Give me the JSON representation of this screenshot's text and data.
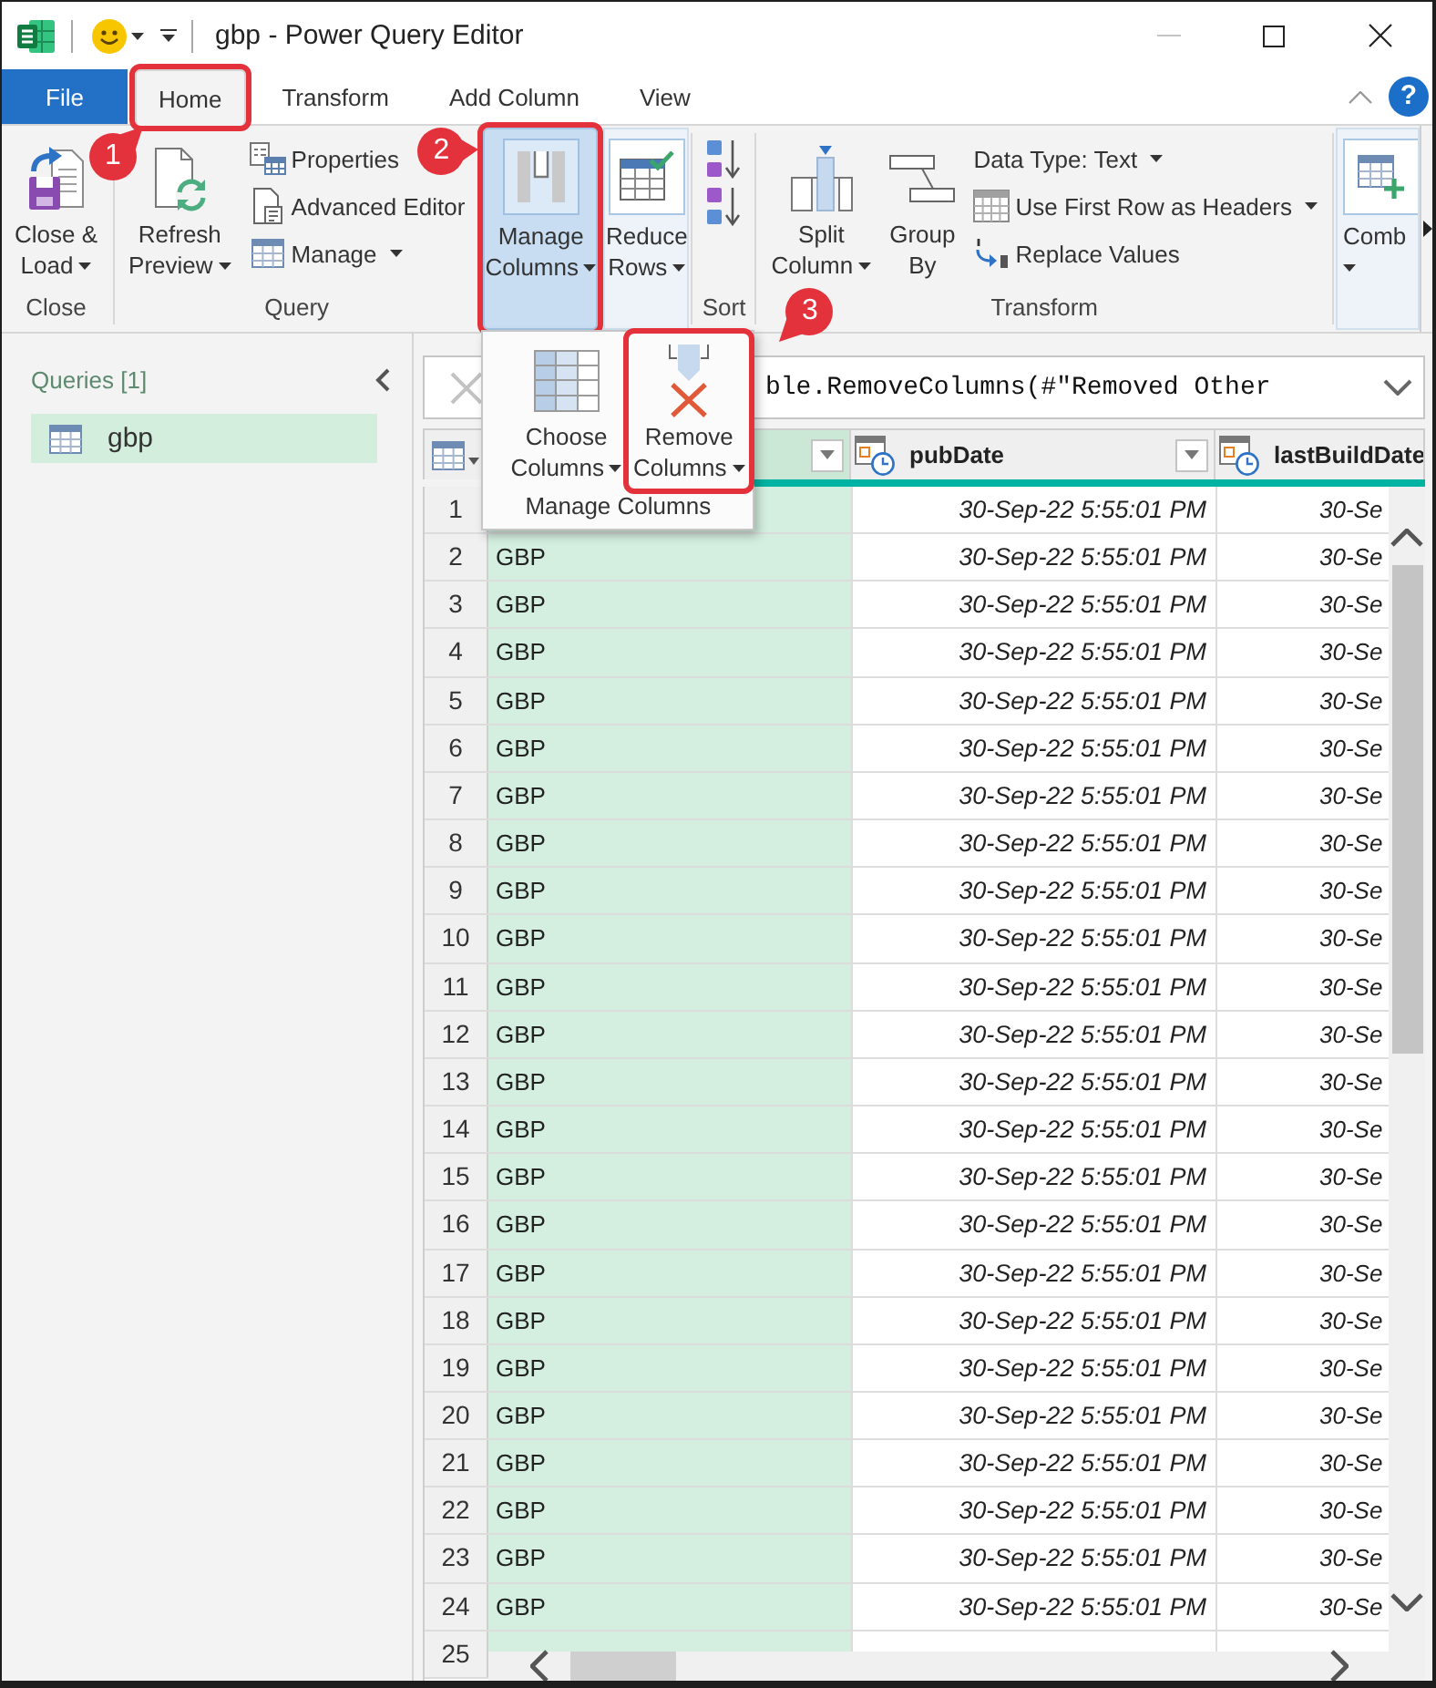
{
  "window": {
    "title": "gbp - Power Query Editor"
  },
  "tabs": [
    {
      "label": "File",
      "kind": "file",
      "selected": false
    },
    {
      "label": "Home",
      "kind": "tab",
      "selected": true,
      "step": "1"
    },
    {
      "label": "Transform",
      "kind": "tab",
      "selected": false
    },
    {
      "label": "Add Column",
      "kind": "tab",
      "selected": false
    },
    {
      "label": "View",
      "kind": "tab",
      "selected": false
    }
  ],
  "help_button": "?",
  "ribbon": {
    "groups": [
      {
        "kind": "group",
        "label": "Close",
        "items": [
          {
            "kind": "large",
            "lines": [
              "Close &",
              "Load"
            ],
            "dropdown": true
          }
        ]
      },
      {
        "kind": "group",
        "label": "Query",
        "items": [
          {
            "kind": "large",
            "lines": [
              "Refresh",
              "Preview"
            ],
            "dropdown": true
          },
          {
            "kind": "small",
            "label": "Properties",
            "dropdown": false
          },
          {
            "kind": "small",
            "label": "Advanced Editor",
            "dropdown": false
          },
          {
            "kind": "small",
            "label": "Manage",
            "dropdown": true
          }
        ]
      },
      {
        "kind": "collapsed",
        "lines": [
          "Manage",
          "Columns"
        ],
        "dropdown": true,
        "expanded": true,
        "step": "2",
        "menu": {
          "label": "Manage Columns",
          "items": [
            {
              "lines": [
                "Choose",
                "Columns"
              ],
              "dropdown": true
            },
            {
              "lines": [
                "Remove",
                "Columns"
              ],
              "dropdown": true,
              "step": "3"
            }
          ]
        }
      },
      {
        "kind": "collapsed",
        "lines": [
          "Reduce",
          "Rows"
        ],
        "dropdown": true,
        "expanded": false
      },
      {
        "kind": "group",
        "label": "Sort",
        "items": [
          {
            "kind": "icon"
          },
          {
            "kind": "icon"
          }
        ]
      },
      {
        "kind": "group",
        "label": "Transform",
        "items": [
          {
            "kind": "large",
            "lines": [
              "Split",
              "Column"
            ],
            "dropdown": true
          },
          {
            "kind": "large",
            "lines": [
              "Group",
              "By"
            ],
            "dropdown": false
          },
          {
            "kind": "small",
            "label": "Data Type: Text",
            "dropdown": true
          },
          {
            "kind": "small",
            "label": "Use First Row as Headers",
            "dropdown": true
          },
          {
            "kind": "small",
            "label": "Replace Values",
            "dropdown": false
          }
        ]
      },
      {
        "kind": "collapsed",
        "lines": [
          "Comb"
        ],
        "dropdown": true,
        "expanded": false
      }
    ]
  },
  "queries": {
    "title": "Queries [1]",
    "items": [
      {
        "label": "gbp",
        "selected": true
      }
    ]
  },
  "formula_bar": {
    "formula": "ble.RemoveColumns(#\"Removed Other"
  },
  "table": {
    "columns": [
      {
        "selected": true,
        "filter": true
      },
      {
        "name": "pubDate",
        "kind": "datetime",
        "selected": false,
        "filter": true
      },
      {
        "name": "lastBuildDate",
        "kind": "datetime",
        "selected": false
      }
    ],
    "rows": [
      {
        "number": "1",
        "cells": [
          null,
          "30-Sep-22 5:55:01 PM",
          "30-Se"
        ]
      },
      {
        "number": "2",
        "cells": [
          "GBP",
          "30-Sep-22 5:55:01 PM",
          "30-Se"
        ]
      },
      {
        "number": "3",
        "cells": [
          "GBP",
          "30-Sep-22 5:55:01 PM",
          "30-Se"
        ]
      },
      {
        "number": "4",
        "cells": [
          "GBP",
          "30-Sep-22 5:55:01 PM",
          "30-Se"
        ]
      },
      {
        "number": "5",
        "cells": [
          "GBP",
          "30-Sep-22 5:55:01 PM",
          "30-Se"
        ]
      },
      {
        "number": "6",
        "cells": [
          "GBP",
          "30-Sep-22 5:55:01 PM",
          "30-Se"
        ]
      },
      {
        "number": "7",
        "cells": [
          "GBP",
          "30-Sep-22 5:55:01 PM",
          "30-Se"
        ]
      },
      {
        "number": "8",
        "cells": [
          "GBP",
          "30-Sep-22 5:55:01 PM",
          "30-Se"
        ]
      },
      {
        "number": "9",
        "cells": [
          "GBP",
          "30-Sep-22 5:55:01 PM",
          "30-Se"
        ]
      },
      {
        "number": "10",
        "cells": [
          "GBP",
          "30-Sep-22 5:55:01 PM",
          "30-Se"
        ]
      },
      {
        "number": "11",
        "cells": [
          "GBP",
          "30-Sep-22 5:55:01 PM",
          "30-Se"
        ]
      },
      {
        "number": "12",
        "cells": [
          "GBP",
          "30-Sep-22 5:55:01 PM",
          "30-Se"
        ]
      },
      {
        "number": "13",
        "cells": [
          "GBP",
          "30-Sep-22 5:55:01 PM",
          "30-Se"
        ]
      },
      {
        "number": "14",
        "cells": [
          "GBP",
          "30-Sep-22 5:55:01 PM",
          "30-Se"
        ]
      },
      {
        "number": "15",
        "cells": [
          "GBP",
          "30-Sep-22 5:55:01 PM",
          "30-Se"
        ]
      },
      {
        "number": "16",
        "cells": [
          "GBP",
          "30-Sep-22 5:55:01 PM",
          "30-Se"
        ]
      },
      {
        "number": "17",
        "cells": [
          "GBP",
          "30-Sep-22 5:55:01 PM",
          "30-Se"
        ]
      },
      {
        "number": "18",
        "cells": [
          "GBP",
          "30-Sep-22 5:55:01 PM",
          "30-Se"
        ]
      },
      {
        "number": "19",
        "cells": [
          "GBP",
          "30-Sep-22 5:55:01 PM",
          "30-Se"
        ]
      },
      {
        "number": "20",
        "cells": [
          "GBP",
          "30-Sep-22 5:55:01 PM",
          "30-Se"
        ]
      },
      {
        "number": "21",
        "cells": [
          "GBP",
          "30-Sep-22 5:55:01 PM",
          "30-Se"
        ]
      },
      {
        "number": "22",
        "cells": [
          "GBP",
          "30-Sep-22 5:55:01 PM",
          "30-Se"
        ]
      },
      {
        "number": "23",
        "cells": [
          "GBP",
          "30-Sep-22 5:55:01 PM",
          "30-Se"
        ]
      },
      {
        "number": "24",
        "cells": [
          "GBP",
          "30-Sep-22 5:55:01 PM",
          "30-Se"
        ]
      },
      {
        "number": "25"
      }
    ]
  }
}
